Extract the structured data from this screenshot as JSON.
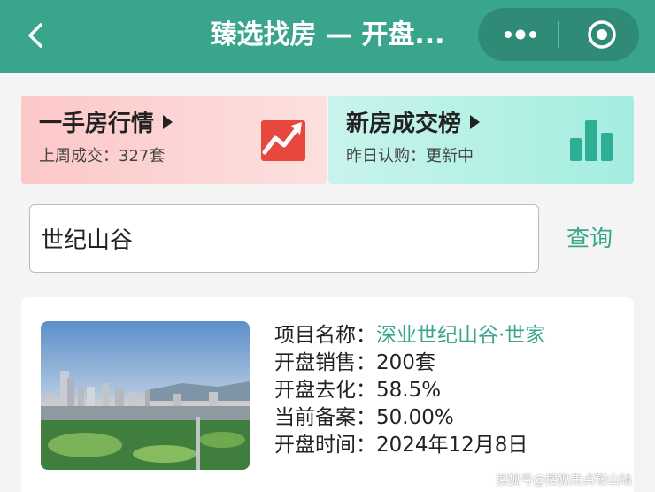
{
  "header": {
    "title": "臻选找房 — 开盘...",
    "bg_color": "#3aa58d"
  },
  "cards": {
    "left": {
      "title": "一手房行情",
      "subtitle": "上周成交：327套",
      "icon": "trend-chart-icon",
      "bg_color": "#fcc8c8"
    },
    "right": {
      "title": "新房成交榜",
      "subtitle": "昨日认购：更新中",
      "icon": "bar-chart-icon",
      "bg_color": "#a4ede0"
    }
  },
  "search": {
    "value": "世纪山谷",
    "button_label": "查询"
  },
  "project": {
    "name_label": "项目名称：",
    "name_value": "深业世纪山谷·世家",
    "sales_label": "开盘销售：",
    "sales_value": "200套",
    "rate_label": "开盘去化：",
    "rate_value": "58.5%",
    "filing_label": "当前备案：",
    "filing_value": "50.00%",
    "date_label": "开盘时间：",
    "date_value": "2024年12月8日"
  },
  "watermark": "搜狐号@搜狐焦点鞍山站",
  "accent_color": "#3aa58d"
}
